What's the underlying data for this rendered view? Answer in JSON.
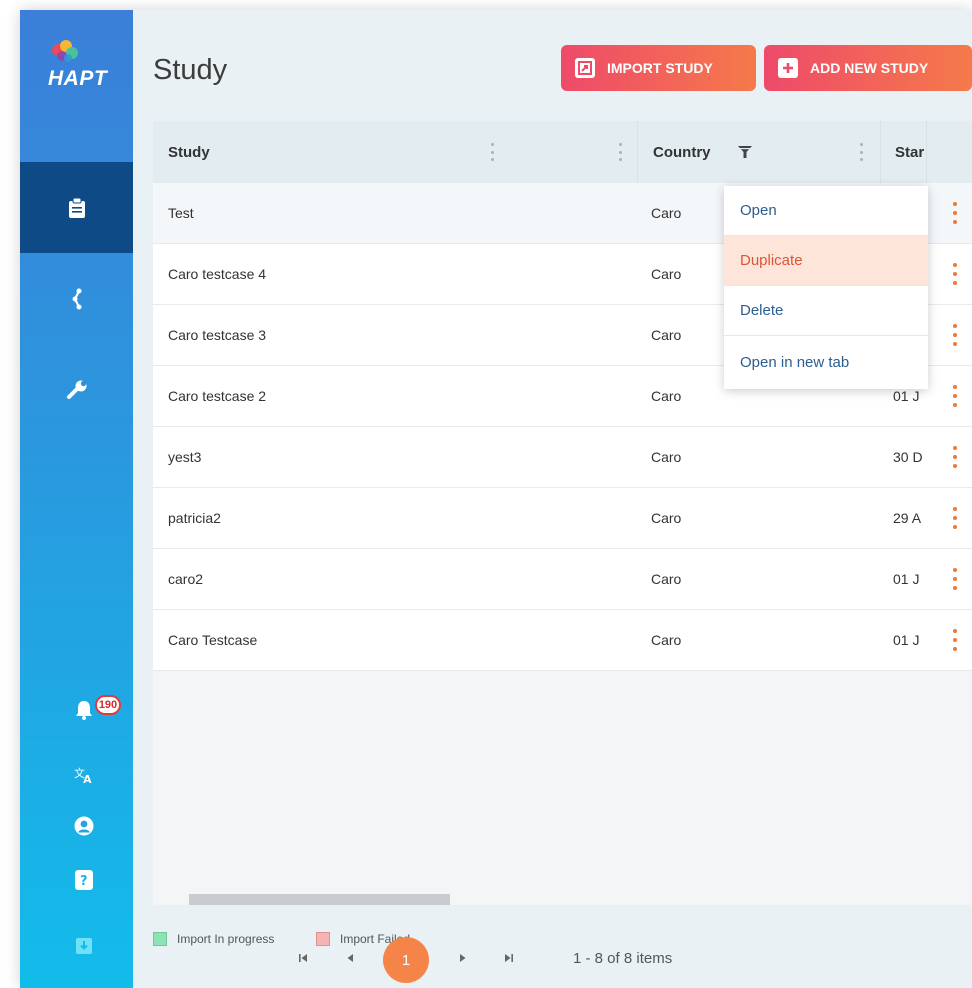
{
  "app": {
    "logo_text": "HAPT"
  },
  "page": {
    "title": "Study"
  },
  "toolbar": {
    "import_label": "IMPORT STUDY",
    "add_label": "ADD NEW STUDY"
  },
  "sidebar": {
    "items": [
      {
        "icon": "clipboard-icon"
      },
      {
        "icon": "flow-icon"
      },
      {
        "icon": "wrench-icon"
      }
    ],
    "notification_count": "190",
    "bottom_icons": [
      "bell-icon",
      "translate-icon",
      "user-icon",
      "help-icon",
      "download-icon"
    ]
  },
  "table": {
    "columns": [
      "Study",
      "Country",
      "Star"
    ],
    "rows": [
      {
        "study": "Test",
        "country": "Caro",
        "start": ""
      },
      {
        "study": "Caro testcase 4",
        "country": "Caro",
        "start": ""
      },
      {
        "study": "Caro testcase 3",
        "country": "Caro",
        "start": ""
      },
      {
        "study": "Caro testcase 2",
        "country": "Caro",
        "start": "01 J"
      },
      {
        "study": "yest3",
        "country": "Caro",
        "start": "30 D"
      },
      {
        "study": "patricia2",
        "country": "Caro",
        "start": "29 A"
      },
      {
        "study": "caro2",
        "country": "Caro",
        "start": "01 J"
      },
      {
        "study": "Caro Testcase",
        "country": "Caro",
        "start": "01 J"
      }
    ]
  },
  "context_menu": {
    "items": [
      "Open",
      "Duplicate",
      "Delete",
      "Open in new tab"
    ],
    "highlighted": "Duplicate"
  },
  "legend": {
    "in_progress": {
      "label": "Import In progress",
      "color": "#8de3b5"
    },
    "failed": {
      "label": "Import Failed",
      "color": "#f5b4b4"
    }
  },
  "pagination": {
    "current_page": "1",
    "summary": "1 - 8 of 8 items"
  },
  "colors": {
    "accent": "#f58448",
    "sidebar_active": "#0d4a86",
    "link": "#2a5e90"
  }
}
